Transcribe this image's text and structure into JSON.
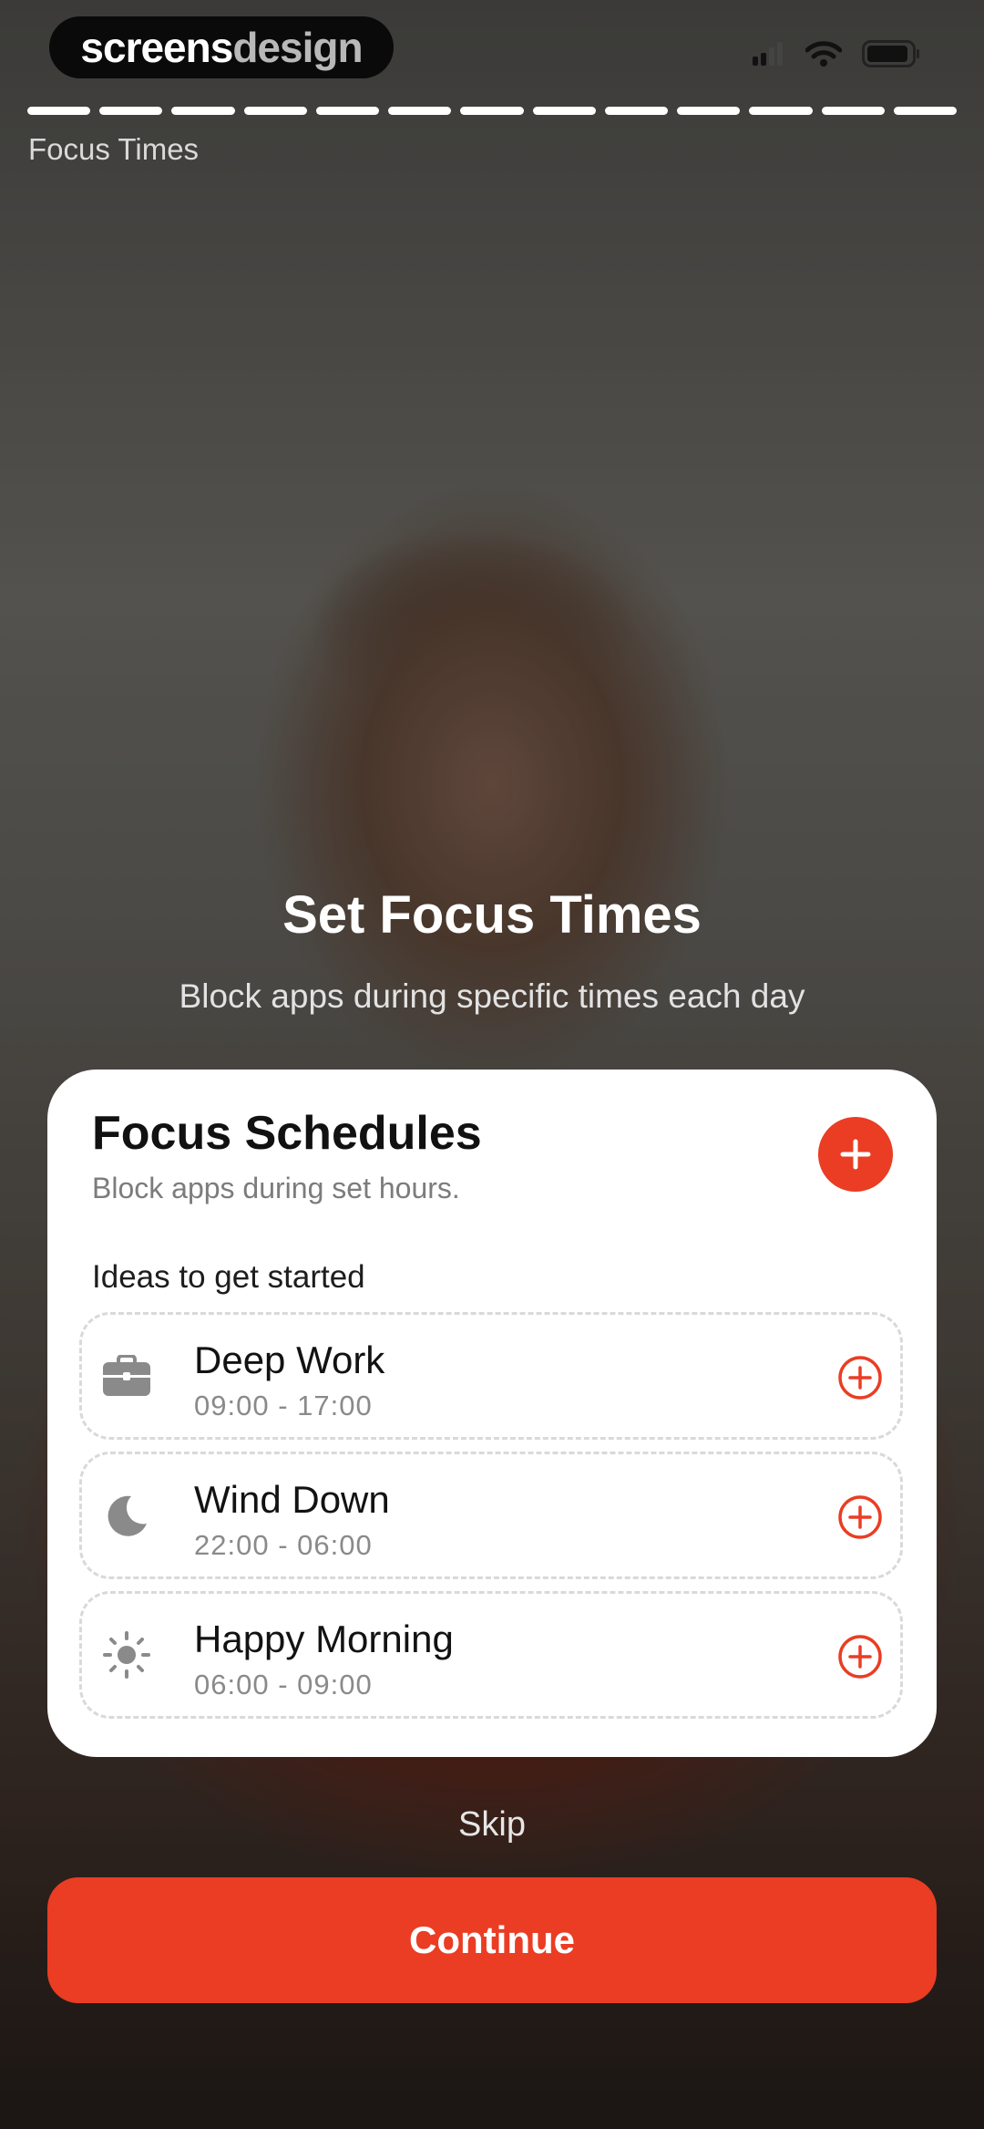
{
  "brand": {
    "part1": "screens",
    "part2": "design"
  },
  "progress": {
    "total_steps": 13,
    "completed_steps": 13
  },
  "header": {
    "step_label": "Focus Times"
  },
  "hero": {
    "title": "Set Focus Times",
    "subtitle": "Block apps during specific times each day"
  },
  "card": {
    "title": "Focus Schedules",
    "subtitle": "Block apps during set hours.",
    "ideas_label": "Ideas to get started",
    "ideas": [
      {
        "name": "Deep Work",
        "time": "09:00 - 17:00",
        "icon": "briefcase-icon"
      },
      {
        "name": "Wind Down",
        "time": "22:00 - 06:00",
        "icon": "moon-icon"
      },
      {
        "name": "Happy Morning",
        "time": "06:00 - 09:00",
        "icon": "sun-icon"
      }
    ]
  },
  "footer": {
    "skip_label": "Skip",
    "continue_label": "Continue"
  },
  "colors": {
    "accent": "#ea3d24",
    "card_bg": "#ffffff",
    "icon_gray": "#8a8a8a"
  }
}
